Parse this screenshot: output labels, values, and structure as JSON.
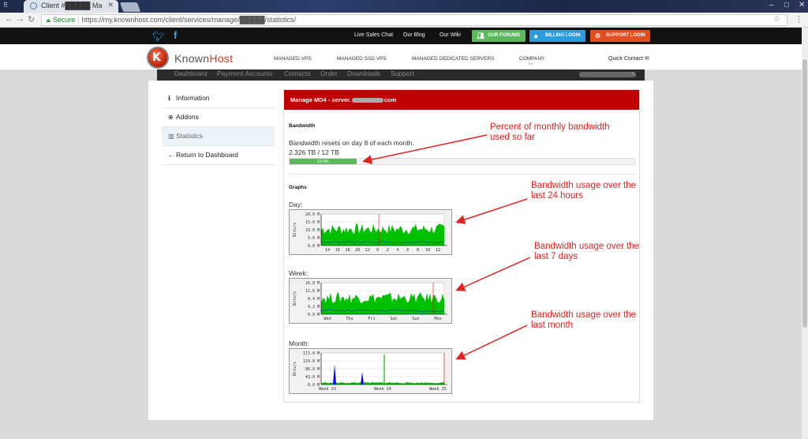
{
  "browser": {
    "tab_title": "Client #█████ Ma",
    "secure_label": "Secure",
    "url": "https://my.knownhost.com/client/services/manage/█████/statistics/"
  },
  "topbar": {
    "links": [
      "Live Sales Chat",
      "Our Blog",
      "Our Wiki"
    ],
    "buttons": [
      {
        "label": "OUR FORUMS",
        "color": "#5cb85c",
        "icon": "users-icon"
      },
      {
        "label": "BILLING LOGIN",
        "color": "#2e9bdc",
        "icon": "lock-icon"
      },
      {
        "label": "SUPPORT LOGIN",
        "color": "#e0501e",
        "icon": "gear-icon"
      }
    ]
  },
  "header": {
    "brand_known": "Known",
    "brand_host": "Host",
    "nav": [
      "MANAGED VPS",
      "MANAGED SSD VPS",
      "MANAGED DEDICATED SERVERS",
      "COMPANY"
    ],
    "quick_contact": "Quick Contact"
  },
  "subnav": [
    "Dashboard",
    "Payment Accounts",
    "Contacts",
    "Order",
    "Downloads",
    "Support"
  ],
  "sidebar": {
    "items": [
      {
        "label": "Information",
        "icon": "info-icon"
      },
      {
        "label": "Addons",
        "icon": "plus-circle-icon"
      },
      {
        "label": "Statistics",
        "icon": "bar-chart-icon",
        "active": true
      },
      {
        "label": "Return to Dashboard",
        "icon": "arrow-left-icon"
      }
    ]
  },
  "panel": {
    "title_prefix": "Manage MD4 - server.",
    "title_suffix": "com",
    "bandwidth_heading": "Bandwidth",
    "bandwidth_reset": "Bandwidth resets on day 8 of each month.",
    "bandwidth_usage": "2.326 TB / 12 TB",
    "bandwidth_percent": 19.4,
    "bandwidth_percent_label": "19.4%",
    "graphs_heading": "Graphs",
    "graphs": [
      {
        "label": "Day:",
        "y_ticks": [
          "20.0 M",
          "15.0 M",
          "10.0 M",
          "5.0 M",
          "0.0 M"
        ],
        "x_ticks": [
          "14",
          "16",
          "18",
          "20",
          "22",
          "0",
          "2",
          "4",
          "6",
          "8",
          "10",
          "12"
        ],
        "y_axis_label": "Bits/s"
      },
      {
        "label": "Week:",
        "y_ticks": [
          "16.8 M",
          "12.6 M",
          "8.4 M",
          "4.2 M",
          "0.0 M"
        ],
        "x_ticks": [
          "Wed",
          "Thu",
          "Fri",
          "Sat",
          "Sun",
          "Mon"
        ],
        "y_axis_label": "Bits/s"
      },
      {
        "label": "Month:",
        "y_ticks": [
          "172.0 M",
          "129.0 M",
          "86.0 M",
          "43.0 M",
          "0.0 M"
        ],
        "x_ticks": [
          "Week 23",
          "Week 24",
          "Week 25"
        ],
        "y_axis_label": "Bits/s"
      }
    ]
  },
  "annotations": [
    "Percent of monthly bandwidth used so far",
    "Bandwidth usage over the last 24 hours",
    "Bandwidth usage over the last 7 days",
    "Bandwidth usage over the last month"
  ],
  "colors": {
    "panel_header": "#c00000",
    "progress": "#5cb85c",
    "annotation": "#e52222",
    "graph_fill": "#00c000",
    "graph_blue": "#0000ff"
  }
}
